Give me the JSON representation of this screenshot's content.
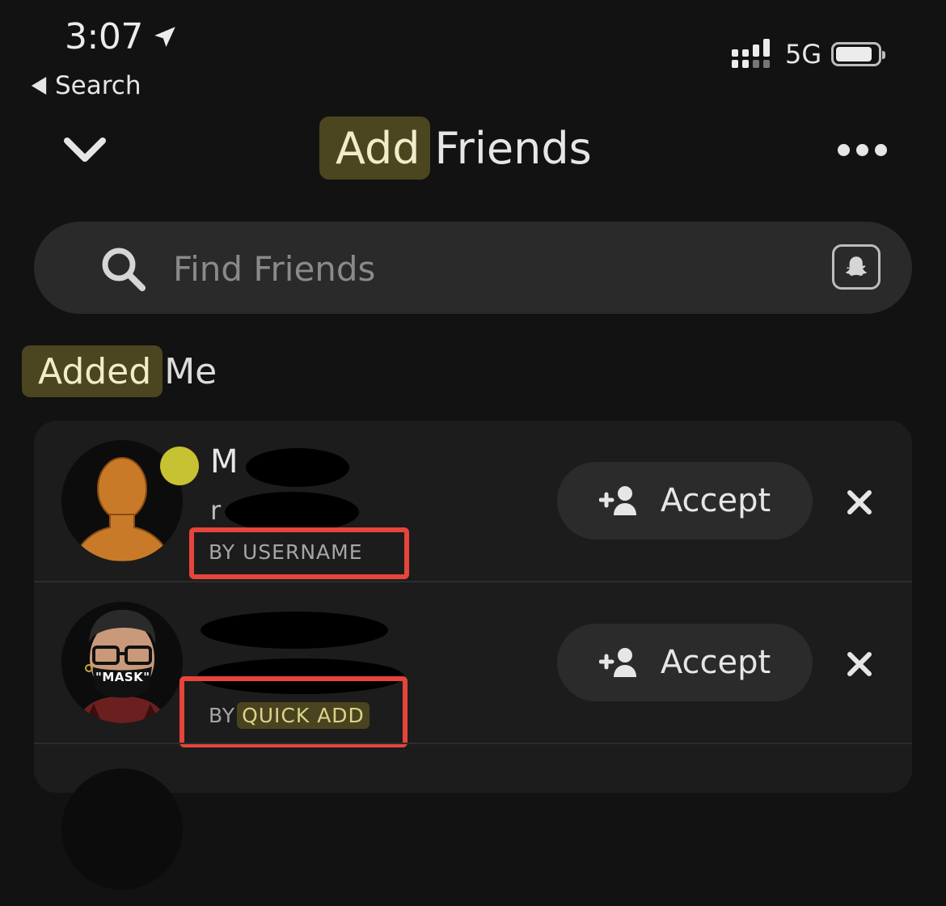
{
  "status_bar": {
    "time": "3:07",
    "back_label": "Search",
    "network": "5G"
  },
  "header": {
    "title_highlight": "Add",
    "title_rest": "Friends"
  },
  "search": {
    "placeholder": "Find Friends"
  },
  "section": {
    "title_highlight": "Added",
    "title_rest": "Me"
  },
  "requests": [
    {
      "source": "BY USERNAME",
      "accept_label": "Accept",
      "online": true
    },
    {
      "source_prefix": "BY",
      "source_highlight": "QUICK ADD",
      "accept_label": "Accept",
      "avatar_text": "\"MASK\""
    }
  ],
  "colors": {
    "background": "#121212",
    "highlight_bg": "#4b4520",
    "online_dot": "#c6c232",
    "annotation_red": "#e5453b"
  },
  "icons": [
    "location-arrow-icon",
    "back-triangle-icon",
    "signal-icon",
    "battery-icon",
    "chevron-down-icon",
    "more-icon",
    "search-icon",
    "ghost-icon",
    "add-friend-icon",
    "close-icon"
  ]
}
